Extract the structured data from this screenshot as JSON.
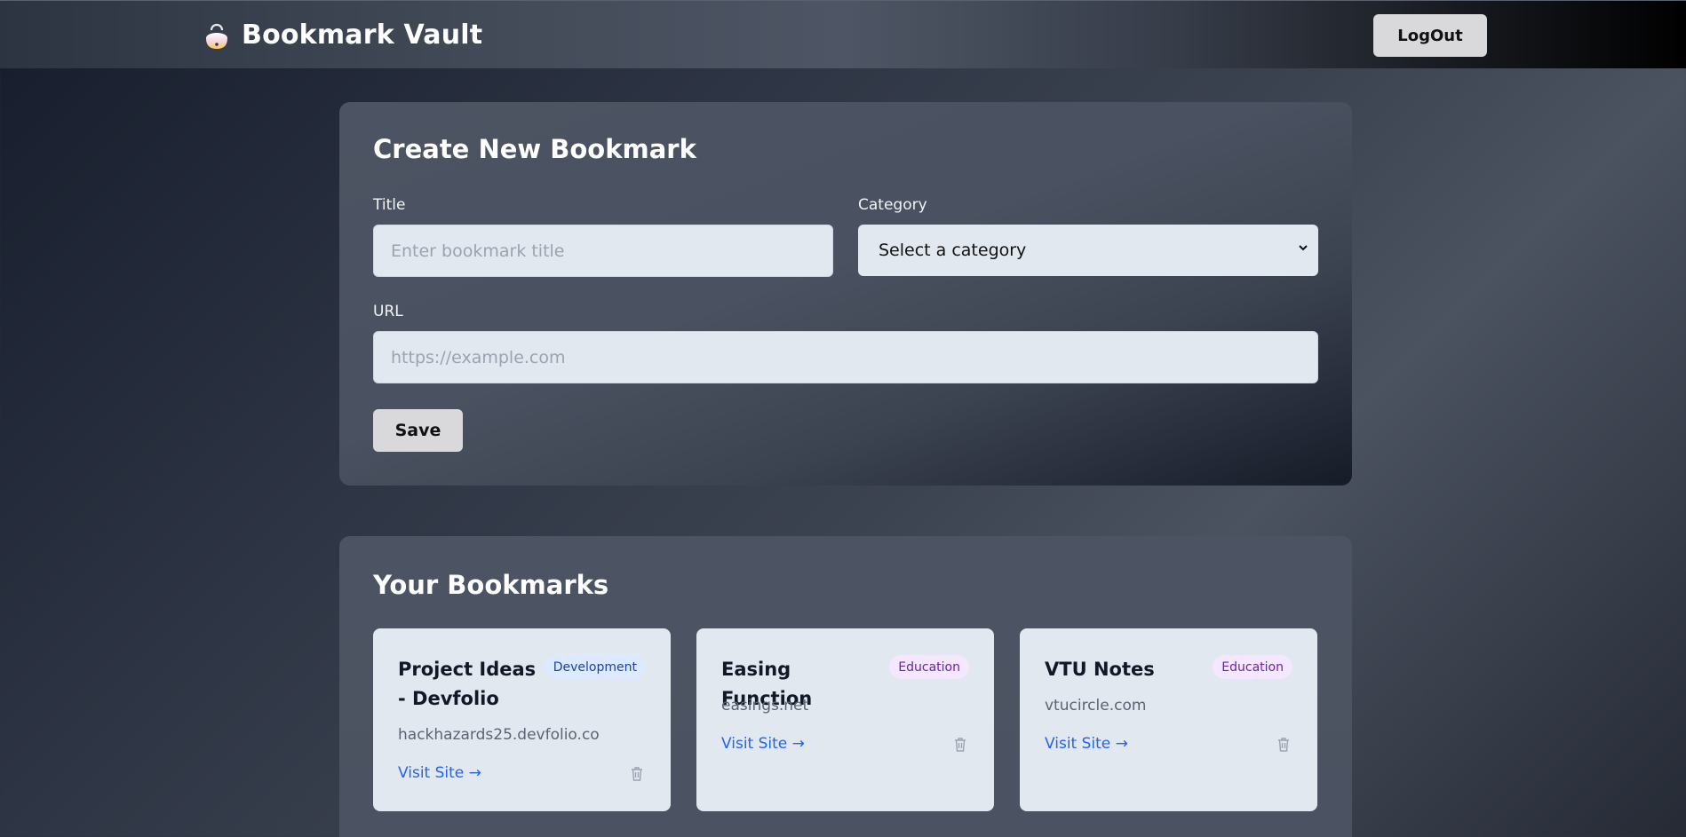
{
  "app": {
    "name": "Bookmark Vault",
    "logout_label": "LogOut"
  },
  "create": {
    "title": "Create New Bookmark",
    "title_label": "Title",
    "title_placeholder": "Enter bookmark title",
    "category_label": "Category",
    "category_selected": "Select a category",
    "url_label": "URL",
    "url_placeholder": "https://example.com",
    "save_label": "Save"
  },
  "list": {
    "title": "Your Bookmarks",
    "visit_label": "Visit Site →",
    "bookmarks": [
      {
        "title": "Project Ideas - Devfolio",
        "category": "Development",
        "domain": "hackhazards25.devfolio.co"
      },
      {
        "title": "Easing Function",
        "category": "Education",
        "domain": "easings.net"
      },
      {
        "title": "VTU Notes",
        "category": "Education",
        "domain": "vtucircle.com"
      }
    ]
  },
  "icons": {
    "logo": "bag-icon",
    "delete": "trash-icon",
    "select": "chevron-down-icon"
  },
  "colors": {
    "link": "#2563eb",
    "badge_development_bg": "#dbeafe",
    "badge_development_text": "#1e40af",
    "badge_education_bg": "#f3e8ff",
    "badge_education_text": "#6b21a8",
    "input_bg": "#e2e8f0"
  }
}
